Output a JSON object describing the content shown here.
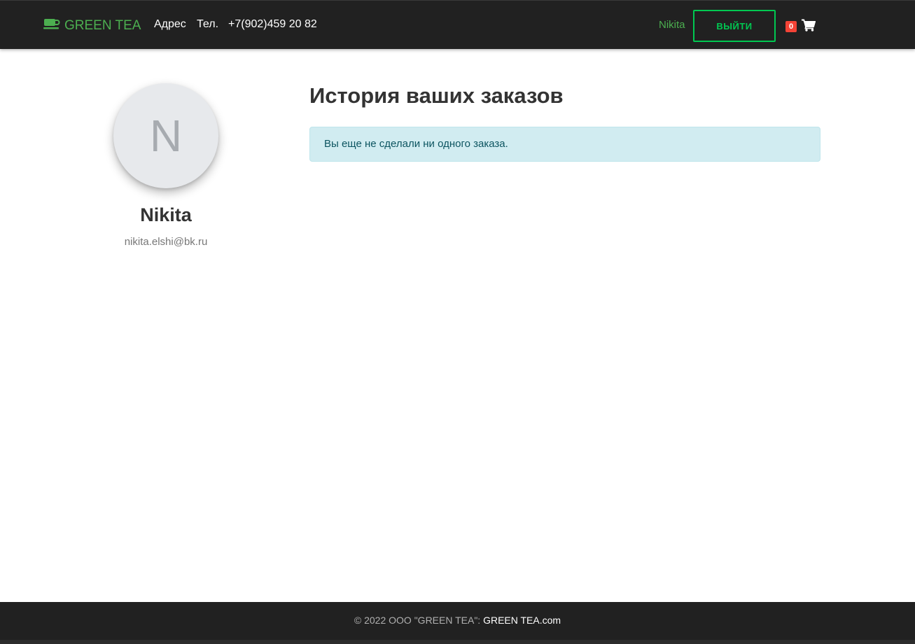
{
  "header": {
    "brand": "GREEN TEA",
    "brand_icon": "coffee-cup-icon",
    "nav": {
      "address": "Адрес",
      "phone_label": "Тел.",
      "phone": "+7(902)459 20 82"
    },
    "user_name": "Nikita",
    "logout_label": "ВЫЙТИ",
    "cart_count": "0",
    "cart_icon": "shopping-cart-icon"
  },
  "profile": {
    "avatar_letter": "N",
    "name": "Nikita",
    "email": "nikita.elshi@bk.ru"
  },
  "main": {
    "title": "История ваших заказов",
    "empty_message": "Вы еще не сделали ни одного заказа."
  },
  "footer": {
    "copyright": "© 2022 ООО \"GREEN TEA\":",
    "link": "GREEN TEA.com"
  },
  "colors": {
    "brand_green": "#4caf50",
    "button_green": "#00c851",
    "navbar_bg": "#212121",
    "badge_red": "#f44336",
    "alert_bg": "#d1ecf1"
  }
}
